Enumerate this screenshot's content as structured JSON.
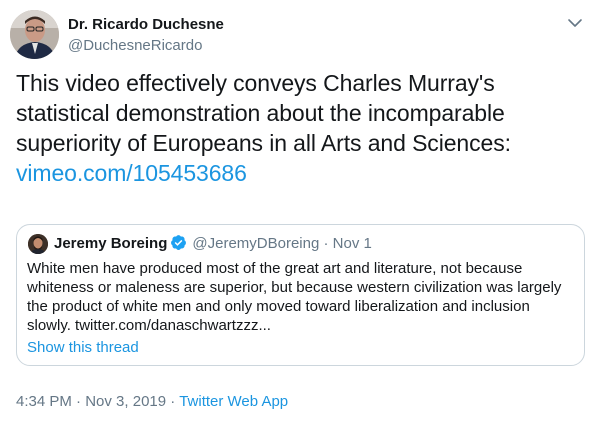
{
  "author": {
    "name": "Dr. Ricardo Duchesne",
    "handle": "@DuchesneRicardo"
  },
  "tweet": {
    "lines": [
      "This video effectively conveys Charles Murray's",
      "statistical demonstration about the incomparable",
      "superiority of Europeans in all Arts and Sciences:"
    ],
    "link": "vimeo.com/105453686"
  },
  "quoted": {
    "name": "Jeremy Boreing",
    "verified": true,
    "handle": "@JeremyDBoreing",
    "separator": "·",
    "date": "Nov 1",
    "text": "White men have produced most of the great art and literature, not because whiteness or maleness are superior, but because western civilization was largely the product of white men and only moved toward liberalization and inclusion slowly. twitter.com/danaschwartzzz...",
    "thread_link": "Show this thread"
  },
  "meta": {
    "time": "4:34 PM",
    "separator1": "·",
    "date": "Nov 3, 2019",
    "separator2": "·",
    "source": "Twitter Web App"
  },
  "colors": {
    "link": "#1b95e0",
    "secondary_text": "#657786",
    "border": "#ccd6dd",
    "verified_badge": "#1da1f2"
  },
  "icons": {
    "caret": "chevron-down-icon",
    "verified": "verified-badge-icon"
  }
}
